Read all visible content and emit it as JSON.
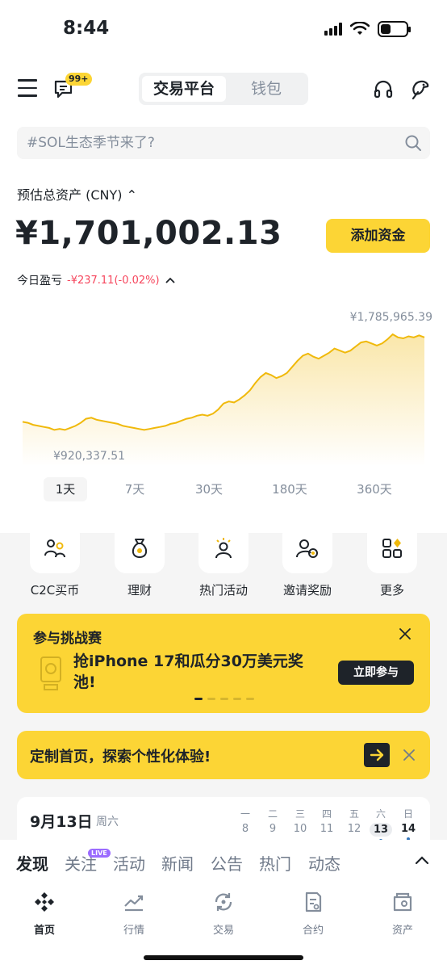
{
  "status_bar": {
    "time": "8:44"
  },
  "header": {
    "badge": "99+",
    "tabs": [
      {
        "label": "交易平台",
        "active": true
      },
      {
        "label": "钱包",
        "active": false
      }
    ]
  },
  "search": {
    "placeholder": "#SOL生态季节来了?"
  },
  "assets": {
    "label": "预估总资产 (CNY) ⌃",
    "total": "¥1,701,002.13",
    "add_funds": "添加资金",
    "pnl_label": "今日盈亏",
    "pnl_value": "-¥237.11(-0.02%)",
    "pnl_color": "#f6465d"
  },
  "chart": {
    "max_label": "¥1,785,965.39",
    "min_label": "¥920,337.51",
    "line_color": "#f0b90b",
    "series": [
      0.14,
      0.13,
      0.11,
      0.1,
      0.09,
      0.08,
      0.06,
      0.07,
      0.06,
      0.08,
      0.1,
      0.13,
      0.17,
      0.18,
      0.16,
      0.15,
      0.14,
      0.13,
      0.12,
      0.1,
      0.09,
      0.08,
      0.07,
      0.06,
      0.07,
      0.08,
      0.09,
      0.1,
      0.12,
      0.13,
      0.15,
      0.17,
      0.18,
      0.2,
      0.21,
      0.2,
      0.22,
      0.26,
      0.32,
      0.34,
      0.33,
      0.36,
      0.4,
      0.45,
      0.52,
      0.58,
      0.62,
      0.6,
      0.57,
      0.59,
      0.62,
      0.68,
      0.74,
      0.79,
      0.81,
      0.78,
      0.76,
      0.79,
      0.82,
      0.86,
      0.84,
      0.82,
      0.84,
      0.88,
      0.92,
      0.93,
      0.91,
      0.89,
      0.91,
      0.95,
      1.0,
      0.97,
      0.96,
      0.98,
      0.97,
      0.99,
      0.97
    ]
  },
  "ranges": [
    {
      "label": "1天",
      "active": true
    },
    {
      "label": "7天",
      "active": false
    },
    {
      "label": "30天",
      "active": false
    },
    {
      "label": "180天",
      "active": false
    },
    {
      "label": "360天",
      "active": false
    }
  ],
  "shortcuts": [
    {
      "label": "C2C买币",
      "icon": "users-icon"
    },
    {
      "label": "理财",
      "icon": "money-bag-icon"
    },
    {
      "label": "热门活动",
      "icon": "person-sparkle-icon"
    },
    {
      "label": "邀请奖励",
      "icon": "invite-icon"
    },
    {
      "label": "更多",
      "icon": "grid-icon"
    }
  ],
  "promo": {
    "title": "参与挑战赛",
    "text": "抢iPhone 17和瓜分30万美元奖池!",
    "button": "立即参与"
  },
  "custom_banner": {
    "text": "定制首页，探索个性化体验!"
  },
  "calendar": {
    "date": "9月13日",
    "weekday": "周六",
    "days": [
      {
        "w": "一",
        "d": "8"
      },
      {
        "w": "二",
        "d": "9"
      },
      {
        "w": "三",
        "d": "10"
      },
      {
        "w": "四",
        "d": "11"
      },
      {
        "w": "五",
        "d": "12"
      },
      {
        "w": "六",
        "d": "13"
      },
      {
        "w": "日",
        "d": "14"
      }
    ]
  },
  "feed_tabs": [
    "发现",
    "关注",
    "活动",
    "新闻",
    "公告",
    "热门",
    "动态"
  ],
  "feed_live": "LIVE",
  "bottom_nav": [
    {
      "label": "首页",
      "icon": "home-logo-icon",
      "active": true
    },
    {
      "label": "行情",
      "icon": "market-icon",
      "active": false
    },
    {
      "label": "交易",
      "icon": "trade-icon",
      "active": false
    },
    {
      "label": "合约",
      "icon": "futures-icon",
      "active": false
    },
    {
      "label": "资产",
      "icon": "wallet-icon",
      "active": false
    }
  ]
}
